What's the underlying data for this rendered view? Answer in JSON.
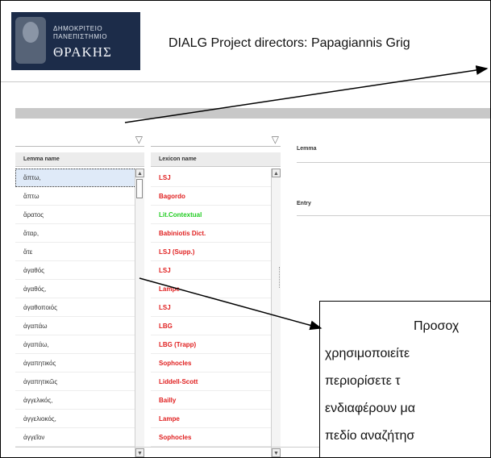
{
  "header": {
    "logo_line1": "ΔΗΜΟΚΡΙΤΕΙΟ",
    "logo_line2": "ΠΑΝΕΠΙΣΤΗΜΙΟ",
    "logo_line3": "ΘΡΑΚΗΣ",
    "title": "DIALG Project directors: Papagiannis Grig"
  },
  "colors": {
    "logo_bg": "#1c2c49",
    "toolbar_strip": "#c8c8c8",
    "selected_row": "#dfeaf8"
  },
  "left_column": {
    "header": "Lemma name",
    "rows": [
      "ἅπτω,",
      "ἅπτω",
      "ἄρατος",
      "ἄταρ,",
      "ἄτε",
      "ἀγαθός",
      "ἀγαθός,",
      "ἀγαθοποιός",
      "ἀγαπάω",
      "ἀγαπάω,",
      "ἀγαπητικός",
      "ἀγαπητικῶς",
      "ἀγγελικός,",
      "ἀγγελιοκός,",
      "ἀγγεῖον"
    ]
  },
  "right_column": {
    "header": "Lexicon name",
    "rows": [
      {
        "label": "LSJ",
        "color": "#e02020"
      },
      {
        "label": "Bagordo",
        "color": "#e02020"
      },
      {
        "label": "Lit.Contextual",
        "color": "#22cc22"
      },
      {
        "label": "Babiniotis Dict.",
        "color": "#e02020"
      },
      {
        "label": "LSJ (Supp.)",
        "color": "#e02020"
      },
      {
        "label": "LSJ",
        "color": "#e02020"
      },
      {
        "label": "Lampe",
        "color": "#e02020"
      },
      {
        "label": "LSJ",
        "color": "#e02020"
      },
      {
        "label": "LBG",
        "color": "#e02020"
      },
      {
        "label": "LBG (Trapp)",
        "color": "#e02020"
      },
      {
        "label": "Sophocles",
        "color": "#e02020"
      },
      {
        "label": "Liddell-Scott",
        "color": "#e02020"
      },
      {
        "label": "Bailly",
        "color": "#e02020"
      },
      {
        "label": "Lampe",
        "color": "#e02020"
      },
      {
        "label": "Sophocles",
        "color": "#e02020"
      }
    ]
  },
  "detail": {
    "field1_label": "Lemma",
    "field2_label": "Entry"
  },
  "callout": {
    "lines": [
      "Προσοχ",
      "χρησιμοποιείτε",
      "περιορίσετε    τ",
      "ενδιαφέρουν μα",
      "πεδίο αναζήτησ"
    ]
  }
}
